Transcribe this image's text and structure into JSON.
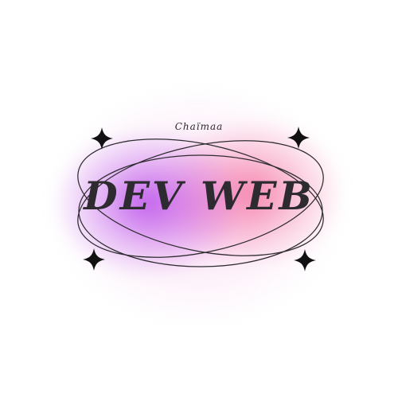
{
  "logo": {
    "top_text": "Chaïmaa",
    "title": "DEV WEB",
    "colors": {
      "background": "#ffffff",
      "purple_glow": "#b74aec",
      "pink_glow": "#f46896",
      "ink": "#2d2b30"
    },
    "icons": [
      "sparkle-icon",
      "sparkle-icon",
      "sparkle-icon",
      "sparkle-icon"
    ]
  }
}
